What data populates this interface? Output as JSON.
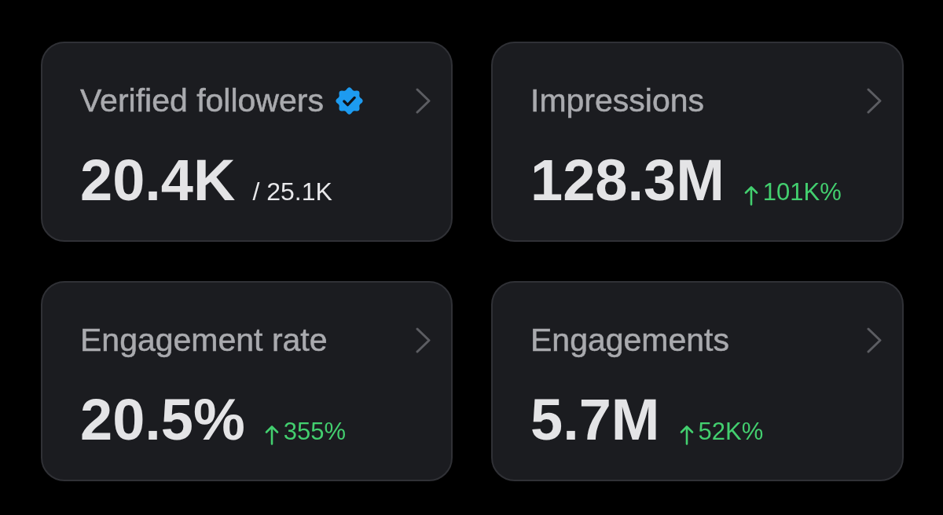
{
  "cards": [
    {
      "kind": "total",
      "title": "Verified followers",
      "verified": true,
      "value": "20.4K",
      "total": "/ 25.1K"
    },
    {
      "kind": "change",
      "title": "Impressions",
      "verified": false,
      "value": "128.3M",
      "increase": true,
      "change": "101K%"
    },
    {
      "kind": "change",
      "title": "Engagement rate",
      "verified": false,
      "value": "20.5%",
      "increase": true,
      "change": "355%"
    },
    {
      "kind": "change",
      "title": "Engagements",
      "verified": false,
      "value": "5.7M",
      "increase": true,
      "change": "52K%"
    }
  ]
}
